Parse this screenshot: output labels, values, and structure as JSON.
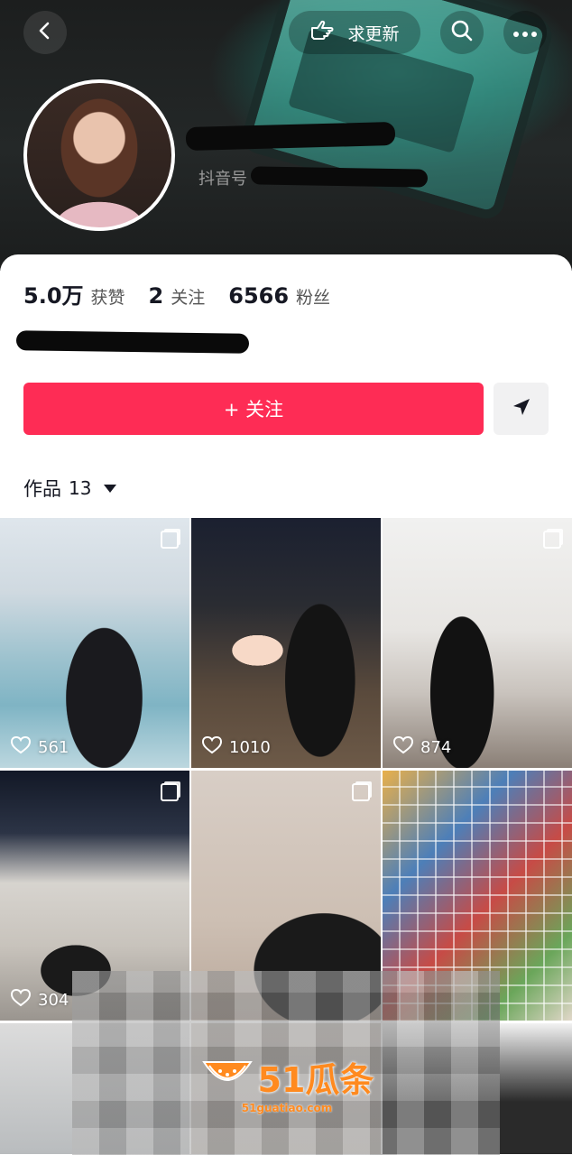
{
  "header": {
    "update_button_label": "求更新",
    "douyin_id_label": "抖音号"
  },
  "profile": {
    "stats": [
      {
        "value": "5.0万",
        "label": "获赞"
      },
      {
        "value": "2",
        "label": "关注"
      },
      {
        "value": "6566",
        "label": "粉丝"
      }
    ]
  },
  "actions": {
    "follow_label": "+ 关注"
  },
  "works_tab": {
    "label": "作品",
    "count": "13"
  },
  "grid": {
    "items": [
      {
        "likes": "561",
        "multi_image": true
      },
      {
        "likes": "1010",
        "multi_image": false
      },
      {
        "likes": "874",
        "multi_image": true
      },
      {
        "likes": "304",
        "multi_image": true
      },
      {
        "likes": "",
        "multi_image": true
      },
      {
        "likes": "",
        "multi_image": false
      }
    ]
  },
  "watermark": {
    "brand": "51瓜条",
    "url": "51guatiao.com"
  },
  "colors": {
    "accent": "#fe2c55",
    "text_primary": "#161823"
  }
}
